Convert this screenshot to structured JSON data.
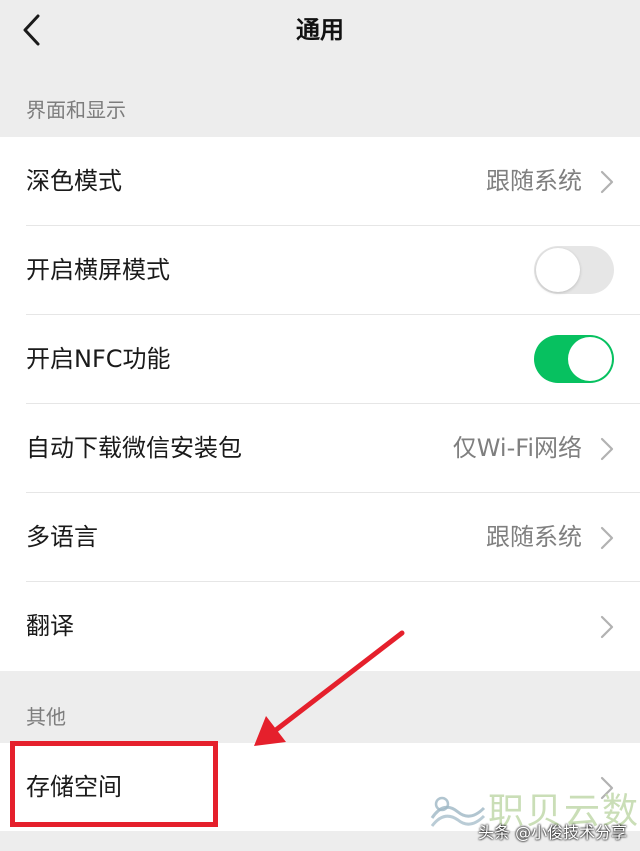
{
  "header": {
    "title": "通用",
    "back_icon": "chevron-left-icon"
  },
  "sections": [
    {
      "title": "界面和显示",
      "items": [
        {
          "label": "深色模式",
          "value": "跟随系统",
          "control": "chevron-right-icon"
        },
        {
          "label": "开启横屏模式",
          "toggle": "off"
        },
        {
          "label": "开启NFC功能",
          "toggle": "on"
        },
        {
          "label": "自动下载微信安装包",
          "value": "仅Wi-Fi网络",
          "control": "chevron-right-icon"
        },
        {
          "label": "多语言",
          "value": "跟随系统",
          "control": "chevron-right-icon"
        },
        {
          "label": "翻译",
          "value": "",
          "control": "chevron-right-icon"
        }
      ]
    },
    {
      "title": "其他",
      "items": [
        {
          "label": "存储空间",
          "value": "",
          "control": "chevron-right-icon"
        }
      ]
    }
  ],
  "colors": {
    "toggle_on": "#07c160",
    "toggle_off": "#e6e6e6",
    "annotation": "#e5202c",
    "background": "#ededed"
  },
  "watermark": {
    "brand_text": "职贝云数",
    "credit_text": "头条 @小俊技术分享"
  }
}
